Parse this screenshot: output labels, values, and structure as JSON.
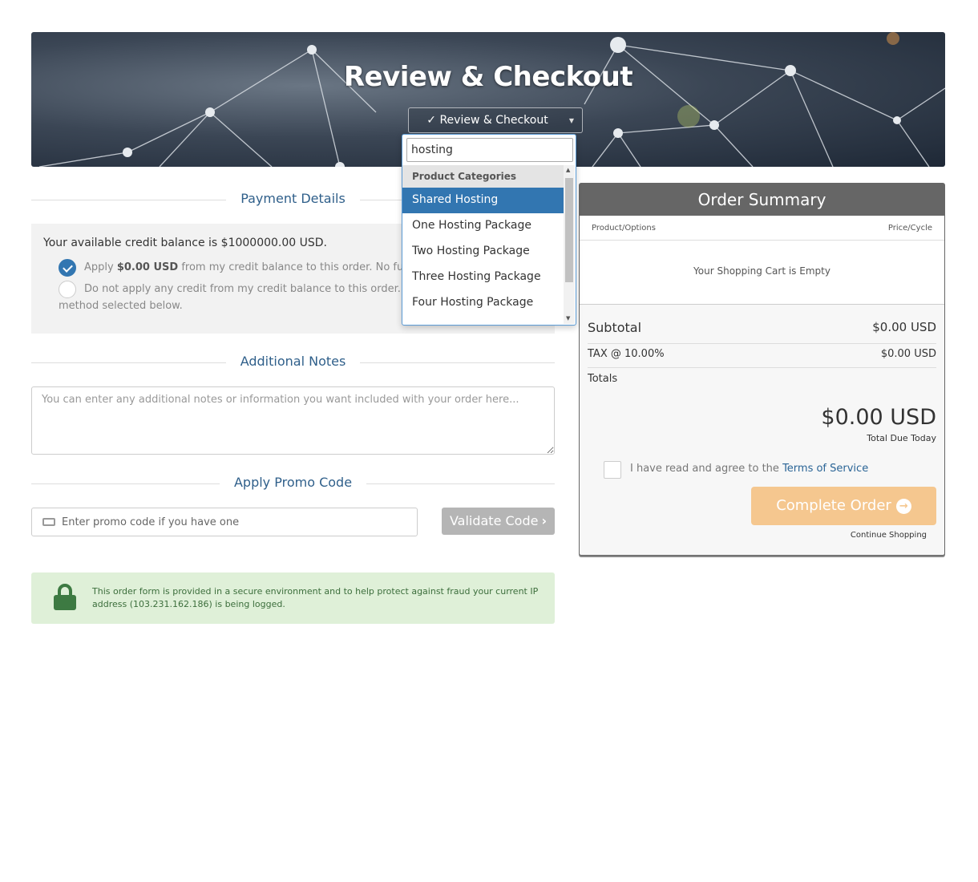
{
  "hero": {
    "title": "Review & Checkout",
    "select_label": "✓ Review & Checkout"
  },
  "dropdown": {
    "search_value": "hosting",
    "group_label": "Product Categories",
    "items": [
      "Shared Hosting",
      "One Hosting Package",
      "Two Hosting Package",
      "Three Hosting Package",
      "Four Hosting Package"
    ],
    "selected": "Shared Hosting"
  },
  "payment": {
    "heading": "Payment Details",
    "credit_balance": "Your available credit balance is $1000000.00 USD.",
    "option1_prefix": "Apply ",
    "option1_amount": "$0.00 USD",
    "option1_suffix": " from my credit balance to this order. No further pa",
    "option2_text": "Do not apply any credit from my credit balance to this order. I will pa",
    "option2_cont": "method selected below."
  },
  "notes": {
    "heading": "Additional Notes",
    "placeholder": "You can enter any additional notes or information you want included with your order here..."
  },
  "promo": {
    "heading": "Apply Promo Code",
    "placeholder": "Enter promo code if you have one",
    "validate_label": "Validate Code"
  },
  "secure": {
    "text_prefix": "This order form is provided in a secure environment and to help protect against fraud your current IP address (",
    "ip": "103.231.162.186",
    "text_suffix": ") is being logged."
  },
  "summary": {
    "heading": "Order Summary",
    "col_product": "Product/Options",
    "col_price": "Price/Cycle",
    "empty": "Your Shopping Cart is Empty",
    "subtotal_label": "Subtotal",
    "subtotal_value": "$0.00 USD",
    "tax_label": "TAX @ 10.00%",
    "tax_value": "$0.00 USD",
    "totals_label": "Totals",
    "total_amount": "$0.00 USD",
    "total_due_label": "Total Due Today",
    "tos_prefix": "I have read and agree to the ",
    "tos_link": "Terms of Service",
    "complete_label": "Complete Order",
    "continue_label": "Continue Shopping"
  },
  "colors": {
    "accent": "#3276b1",
    "heading_blue": "#2f5f8a",
    "complete_button": "#f5c78f",
    "secure_bg": "#dff0d8",
    "summary_header": "#666666"
  }
}
